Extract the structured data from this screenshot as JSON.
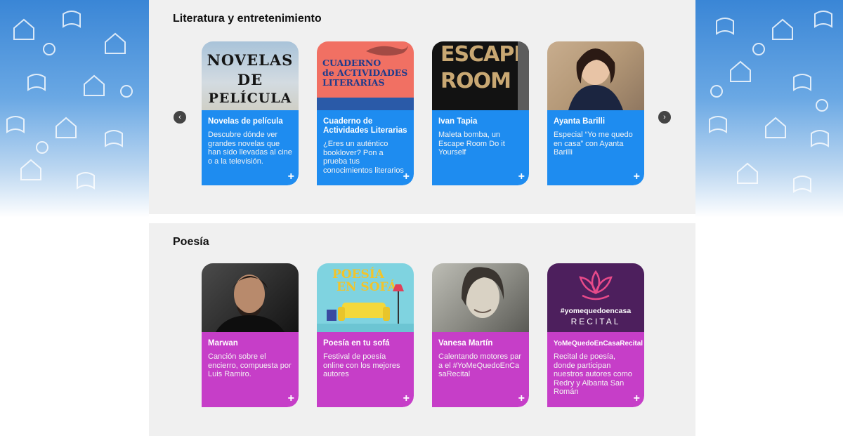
{
  "sections": [
    {
      "title": "Literatura y entretenimiento",
      "cards": [
        {
          "title": "Novelas de película",
          "desc": "Descubre dónde ver grandes novelas que han sido llevadas al cine o a la televisión.",
          "image_text": [
            "NOVELAS",
            "DE",
            "PELÍCULA"
          ]
        },
        {
          "title": "Cuaderno de Actividades Literarias",
          "desc": "¿Eres un auténtico booklover? Pon a prueba tus conocimientos literarios",
          "image_text": [
            "CUADERNO",
            "de ACTIVIDADES",
            "LITERARIAS"
          ]
        },
        {
          "title": "Ivan Tapia",
          "desc": "Maleta bomba, un Escape Room Do it Yourself",
          "image_text": [
            "ESCAPE",
            "ROOM"
          ]
        },
        {
          "title": "Ayanta Barilli",
          "desc": "Especial “Yo me quedo en casa” con Ayanta Barilli"
        }
      ]
    },
    {
      "title": "Poesía",
      "cards": [
        {
          "title": "Marwan",
          "desc": "Canción sobre el encierro, compuesta por Luis Ramiro."
        },
        {
          "title": "Poesía en tu sofá",
          "desc": "Festival de poesía online con los mejores autores",
          "image_text": [
            "POESÍA",
            "EN SOFÁ"
          ]
        },
        {
          "title": "Vanesa Martín",
          "desc": "Calentando motores para el #YoMeQuedoEnCasaRecital"
        },
        {
          "title": "YoMeQuedoEnCasaRecital",
          "desc": "Recital de poesía, donde participan nuestros autores como Redry y Albanta San Román",
          "image_text": [
            "#yomequedoencasa",
            "RECITAL"
          ]
        }
      ]
    }
  ],
  "plus_glyph": "+",
  "arrows": {
    "prev": "‹",
    "next": "›"
  },
  "colors": {
    "lit_card": "#1e8cf0",
    "poe_card": "#c63ec8",
    "section_bg": "#f0f0f0"
  }
}
